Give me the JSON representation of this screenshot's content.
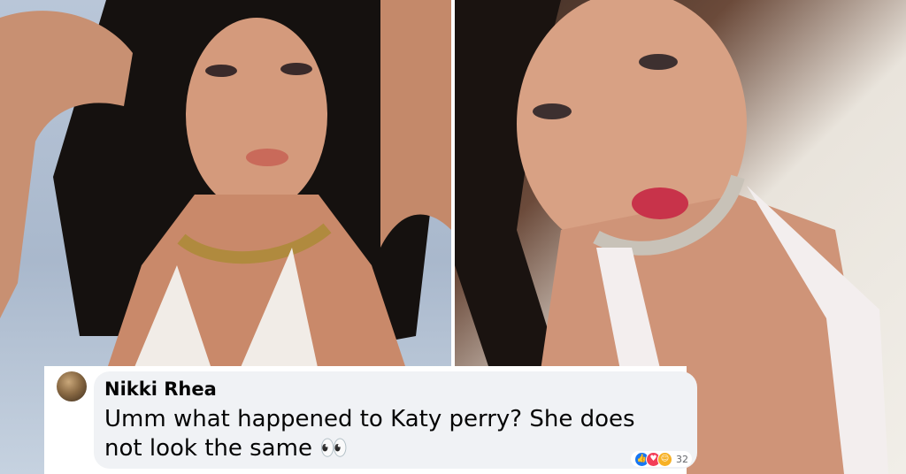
{
  "left_photo": {
    "description_icon": "photo-left-icon"
  },
  "right_photo": {
    "description_icon": "photo-right-icon"
  },
  "comment": {
    "author": "Nikki Rhea",
    "text": "Umm what happened to Katy perry? She does not look the same 👀",
    "reaction_count": "32",
    "reactions": [
      "like-icon",
      "love-icon",
      "haha-icon"
    ]
  },
  "colors": {
    "bubble": "#f0f2f5",
    "like": "#1877f2",
    "love": "#f33e58",
    "haha": "#f7b125"
  }
}
